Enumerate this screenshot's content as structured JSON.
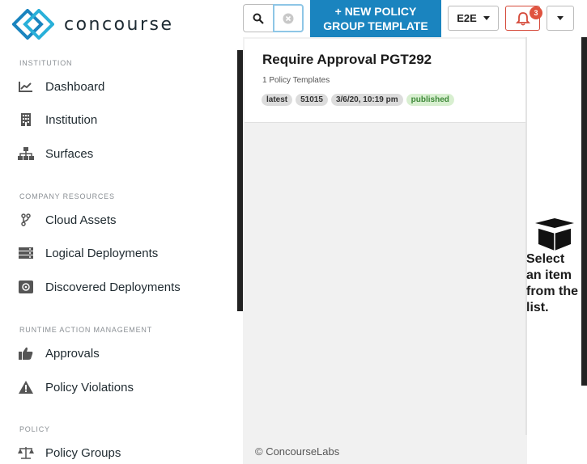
{
  "brand": {
    "name": "concourse"
  },
  "sidebar": {
    "sections": [
      {
        "label": "INSTITUTION"
      },
      {
        "label": "COMPANY RESOURCES"
      },
      {
        "label": "RUNTIME ACTION MANAGEMENT"
      },
      {
        "label": "POLICY"
      }
    ],
    "items": [
      {
        "label": "Dashboard",
        "icon": "chart-line-icon"
      },
      {
        "label": "Institution",
        "icon": "building-icon"
      },
      {
        "label": "Surfaces",
        "icon": "sitemap-icon"
      },
      {
        "label": "Cloud Assets",
        "icon": "branch-icon"
      },
      {
        "label": "Logical Deployments",
        "icon": "server-stack-icon"
      },
      {
        "label": "Discovered Deployments",
        "icon": "radar-icon"
      },
      {
        "label": "Approvals",
        "icon": "thumbs-up-icon"
      },
      {
        "label": "Policy Violations",
        "icon": "warning-icon"
      },
      {
        "label": "Policy Groups",
        "icon": "scale-icon"
      }
    ]
  },
  "toolbar": {
    "new_button_line1": "+ NEW POLICY",
    "new_button_line2": "GROUP TEMPLATE",
    "environment": "E2E",
    "notification_count": "3"
  },
  "list": {
    "items": [
      {
        "title": "Require Approval PGT292",
        "subtitle": "1 Policy Templates",
        "tags": [
          "latest",
          "51015",
          "3/6/20, 10:19 pm",
          "published"
        ]
      }
    ]
  },
  "detail": {
    "empty_message": "Select an item from the list."
  },
  "footer": {
    "copyright": "© ConcourseLabs"
  },
  "colors": {
    "accent": "#1a84bf",
    "alert": "#e0533f",
    "published": "#3f8a3a"
  }
}
